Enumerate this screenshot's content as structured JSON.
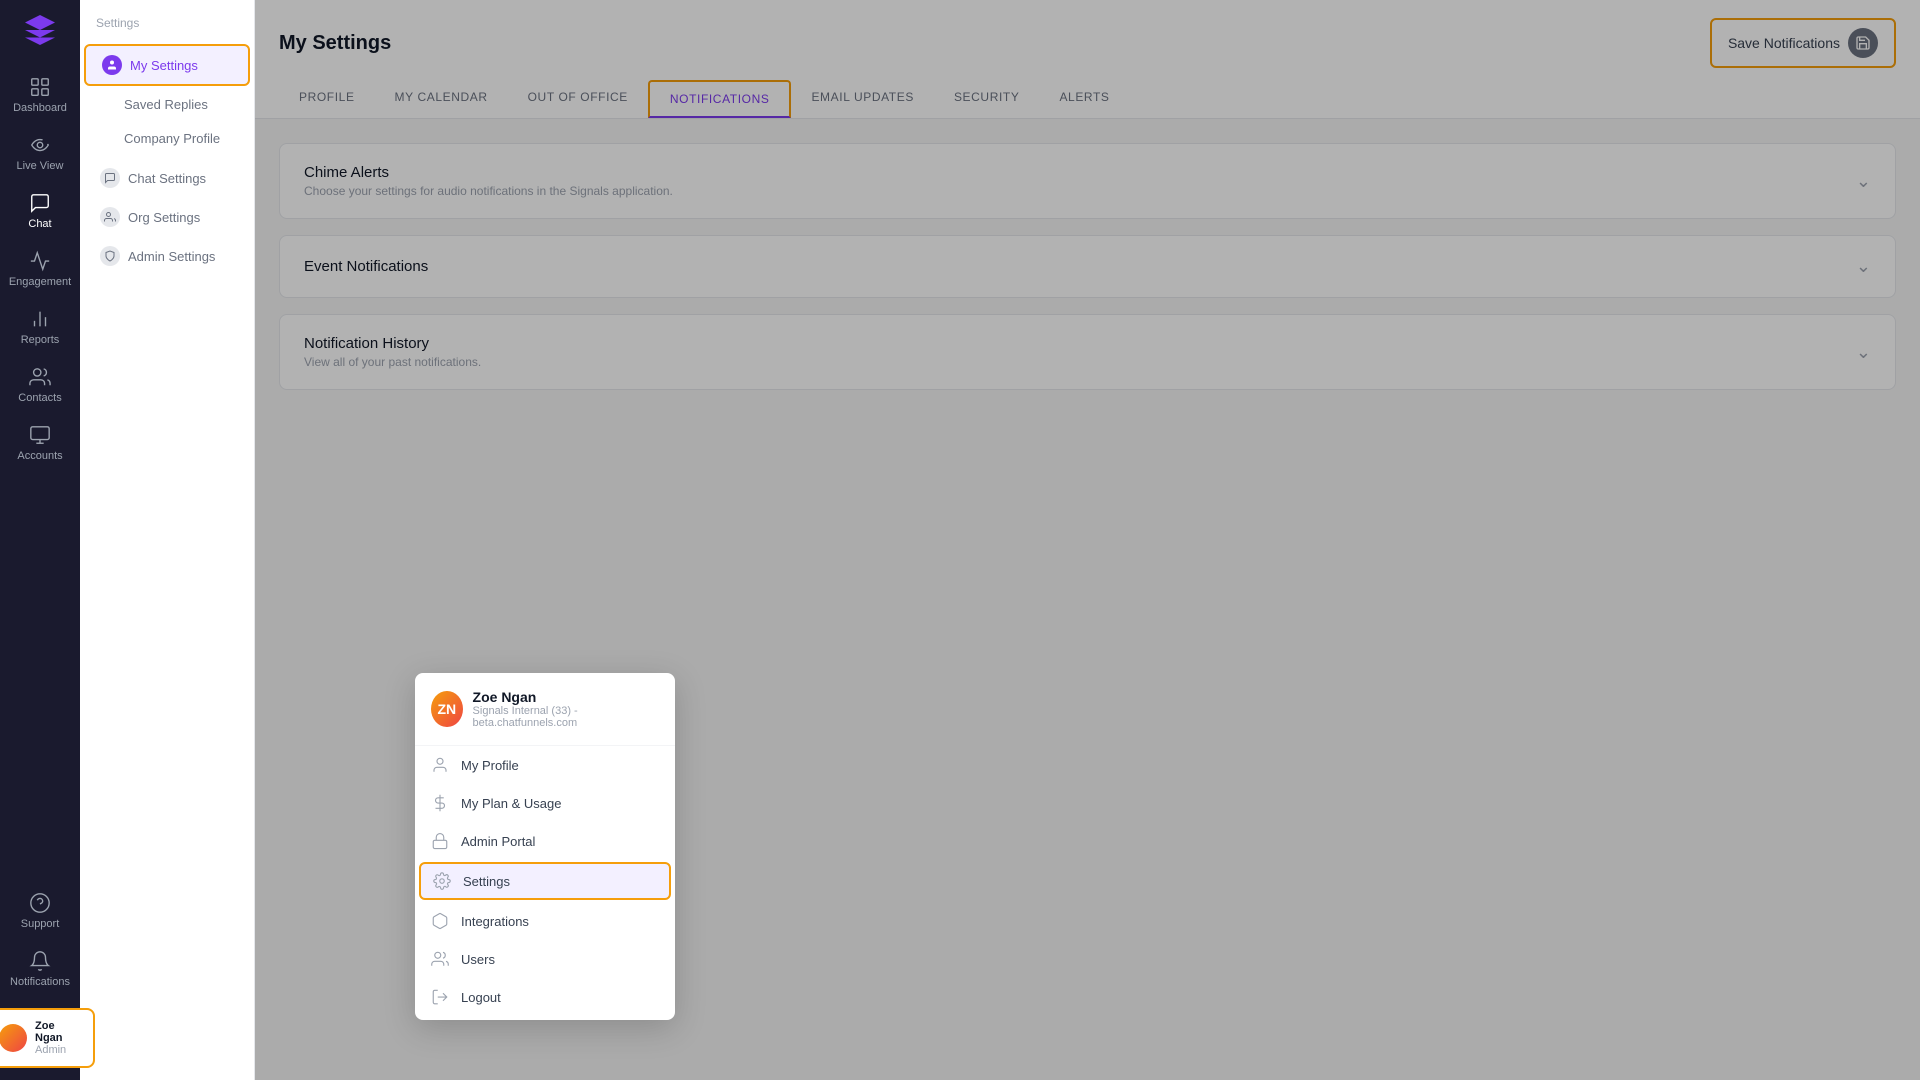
{
  "app": {
    "logo": "▲"
  },
  "left_nav": {
    "items": [
      {
        "id": "dashboard",
        "label": "Dashboard",
        "icon": "dashboard"
      },
      {
        "id": "live-view",
        "label": "Live View",
        "icon": "live"
      },
      {
        "id": "chat",
        "label": "Chat",
        "icon": "chat",
        "active": true
      },
      {
        "id": "engagement",
        "label": "Engagement",
        "icon": "engagement"
      },
      {
        "id": "reports",
        "label": "Reports",
        "icon": "reports"
      },
      {
        "id": "contacts",
        "label": "Contacts",
        "icon": "contacts"
      },
      {
        "id": "accounts",
        "label": "Accounts",
        "icon": "accounts"
      }
    ],
    "bottom": [
      {
        "id": "support",
        "label": "Support",
        "icon": "support"
      },
      {
        "id": "notifications",
        "label": "Notifications",
        "icon": "bell"
      }
    ]
  },
  "settings_sidebar": {
    "title": "Settings",
    "items": [
      {
        "id": "my-settings",
        "label": "My Settings",
        "icon": "person",
        "active": true
      },
      {
        "id": "saved-replies",
        "label": "Saved Replies",
        "icon": null
      },
      {
        "id": "company-profile",
        "label": "Company Profile",
        "icon": null
      }
    ],
    "sections": [
      {
        "id": "chat-settings",
        "label": "Chat Settings",
        "icon": "chat-bubble"
      },
      {
        "id": "org-settings",
        "label": "Org Settings",
        "icon": "org"
      },
      {
        "id": "admin-settings",
        "label": "Admin Settings",
        "icon": "admin"
      }
    ]
  },
  "main": {
    "page_title": "My Settings",
    "save_button": "Save Notifications",
    "tabs": [
      {
        "id": "profile",
        "label": "PROFILE",
        "active": false
      },
      {
        "id": "my-calendar",
        "label": "MY CALENDAR",
        "active": false
      },
      {
        "id": "out-of-office",
        "label": "OUT OF OFFICE",
        "active": false
      },
      {
        "id": "notifications",
        "label": "NOTIFICATIONS",
        "active": true
      },
      {
        "id": "email-updates",
        "label": "EMAIL UPDATES",
        "active": false
      },
      {
        "id": "security",
        "label": "SECURITY",
        "active": false
      },
      {
        "id": "alerts",
        "label": "ALERTS",
        "active": false
      }
    ],
    "sections": [
      {
        "id": "chime-alerts",
        "title": "Chime Alerts",
        "subtitle": "Choose your settings for audio notifications in the Signals application."
      },
      {
        "id": "event-notifications",
        "title": "Event Notifications",
        "subtitle": ""
      },
      {
        "id": "notification-history",
        "title": "Notification History",
        "subtitle": "View all of your past notifications."
      }
    ]
  },
  "dropdown": {
    "user": {
      "name": "Zoe Ngan",
      "company": "Signals Internal (33) - beta.chatfunnels.com"
    },
    "items": [
      {
        "id": "my-profile",
        "label": "My Profile",
        "icon": "person"
      },
      {
        "id": "my-plan",
        "label": "My Plan & Usage",
        "icon": "dollar"
      },
      {
        "id": "admin-portal",
        "label": "Admin Portal",
        "icon": "lock"
      },
      {
        "id": "settings",
        "label": "Settings",
        "icon": "gear",
        "active": true
      },
      {
        "id": "integrations",
        "label": "Integrations",
        "icon": "puzzle"
      },
      {
        "id": "users",
        "label": "Users",
        "icon": "users"
      },
      {
        "id": "logout",
        "label": "Logout",
        "icon": "logout"
      }
    ]
  },
  "nav_user": {
    "name": "Zoe Ngan",
    "role": "Admin"
  }
}
